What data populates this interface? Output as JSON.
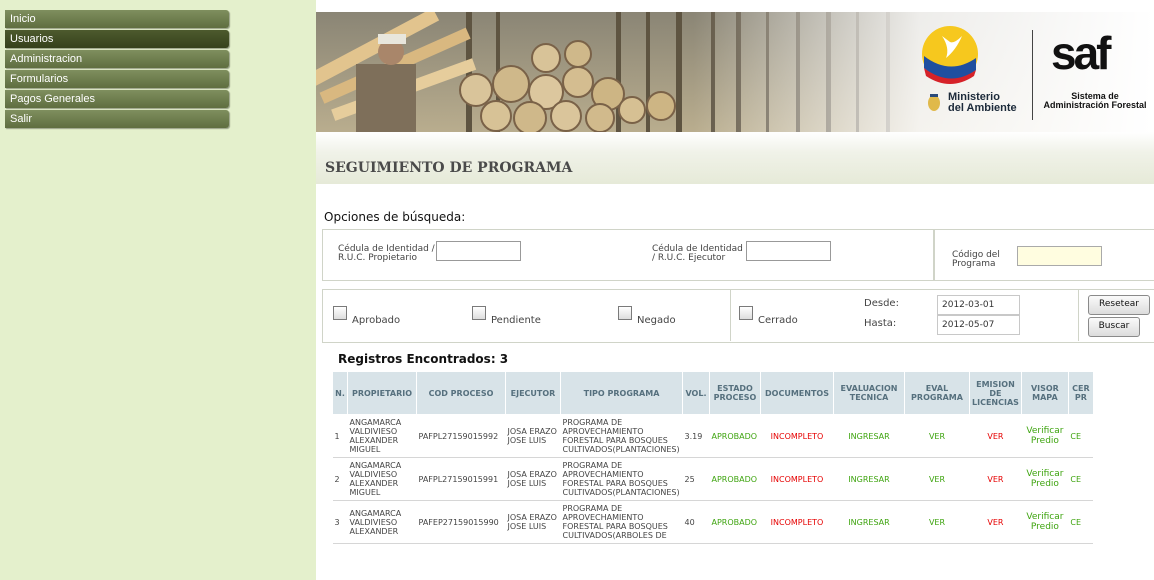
{
  "menu": [
    "Inicio",
    "Usuarios",
    "Administracion",
    "Formularios",
    "Pagos Generales",
    "Salir"
  ],
  "branding": {
    "ministerio_line1": "Ministerio",
    "ministerio_line2": "del Ambiente",
    "saf_logo": "saf",
    "saf_line1": "Sistema de",
    "saf_line2": "Administración Forestal"
  },
  "page_title": "SEGUIMIENTO DE PROGRAMA",
  "search": {
    "heading": "Opciones de búsqueda:",
    "cedula_propietario_label": "Cédula de Identidad / R.U.C. Propietario",
    "cedula_ejecutor_label": "Cédula de Identidad / R.U.C. Ejecutor",
    "codigo_programa_label": "Código del Programa",
    "checkboxes": [
      "Aprobado",
      "Pendiente",
      "Negado",
      "Cerrado"
    ],
    "desde_label": "Desde:",
    "hasta_label": "Hasta:",
    "desde_value": "2012-03-01",
    "hasta_value": "2012-05-07",
    "reset_label": "Resetear",
    "search_label": "Buscar"
  },
  "results": {
    "count_label": "Registros Encontrados: 3",
    "headers": [
      "N.",
      "PROPIETARIO",
      "COD PROCESO",
      "EJECUTOR",
      "TIPO PROGRAMA",
      "VOL.",
      "ESTADO PROCESO",
      "DOCUMENTOS",
      "EVALUACION TECNICA",
      "EVAL PROGRAMA",
      "EMISION DE LICENCIAS",
      "VISOR MAPA",
      "CER PR"
    ],
    "rows": [
      {
        "n": "1",
        "propietario": "ANGAMARCA VALDIVIESO ALEXANDER MIGUEL",
        "cod": "PAFPL27159015992",
        "ejecutor": "JOSA ERAZO JOSE LUIS",
        "tipo": "PROGRAMA DE APROVECHAMIENTO FORESTAL PARA BOSQUES CULTIVADOS(PLANTACIONES)",
        "vol": "3.19",
        "estado": "APROBADO",
        "documentos": "INCOMPLETO",
        "evaluacion": "INGRESAR",
        "eval_programa": "VER",
        "emision": "VER",
        "visor": "Verificar Predio",
        "cer": "CE"
      },
      {
        "n": "2",
        "propietario": "ANGAMARCA VALDIVIESO ALEXANDER MIGUEL",
        "cod": "PAFPL27159015991",
        "ejecutor": "JOSA ERAZO JOSE LUIS",
        "tipo": "PROGRAMA DE APROVECHAMIENTO FORESTAL PARA BOSQUES CULTIVADOS(PLANTACIONES)",
        "vol": "25",
        "estado": "APROBADO",
        "documentos": "INCOMPLETO",
        "evaluacion": "INGRESAR",
        "eval_programa": "VER",
        "emision": "VER",
        "visor": "Verificar Predio",
        "cer": "CE"
      },
      {
        "n": "3",
        "propietario": "ANGAMARCA VALDIVIESO ALEXANDER",
        "cod": "PAFEP27159015990",
        "ejecutor": "JOSA ERAZO JOSE LUIS",
        "tipo": "PROGRAMA DE APROVECHAMIENTO FORESTAL PARA BOSQUES CULTIVADOS(ARBOLES DE",
        "vol": "40",
        "estado": "APROBADO",
        "documentos": "INCOMPLETO",
        "evaluacion": "INGRESAR",
        "eval_programa": "VER",
        "emision": "VER",
        "visor": "Verificar Predio",
        "cer": "CE"
      }
    ]
  }
}
